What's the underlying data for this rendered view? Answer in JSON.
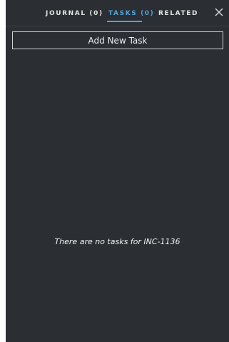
{
  "tabs": [
    {
      "label": "JOURNAL (0)",
      "active": false
    },
    {
      "label": "TASKS (0)",
      "active": true
    },
    {
      "label": "RELATED",
      "active": false
    }
  ],
  "close_icon": "close-icon",
  "add_task_label": "Add New Task",
  "empty_message": "There are no tasks for INC-1136",
  "colors": {
    "panel_bg": "#2b2f33",
    "accent": "#4fa3d9",
    "text": "#e6e6e6"
  }
}
